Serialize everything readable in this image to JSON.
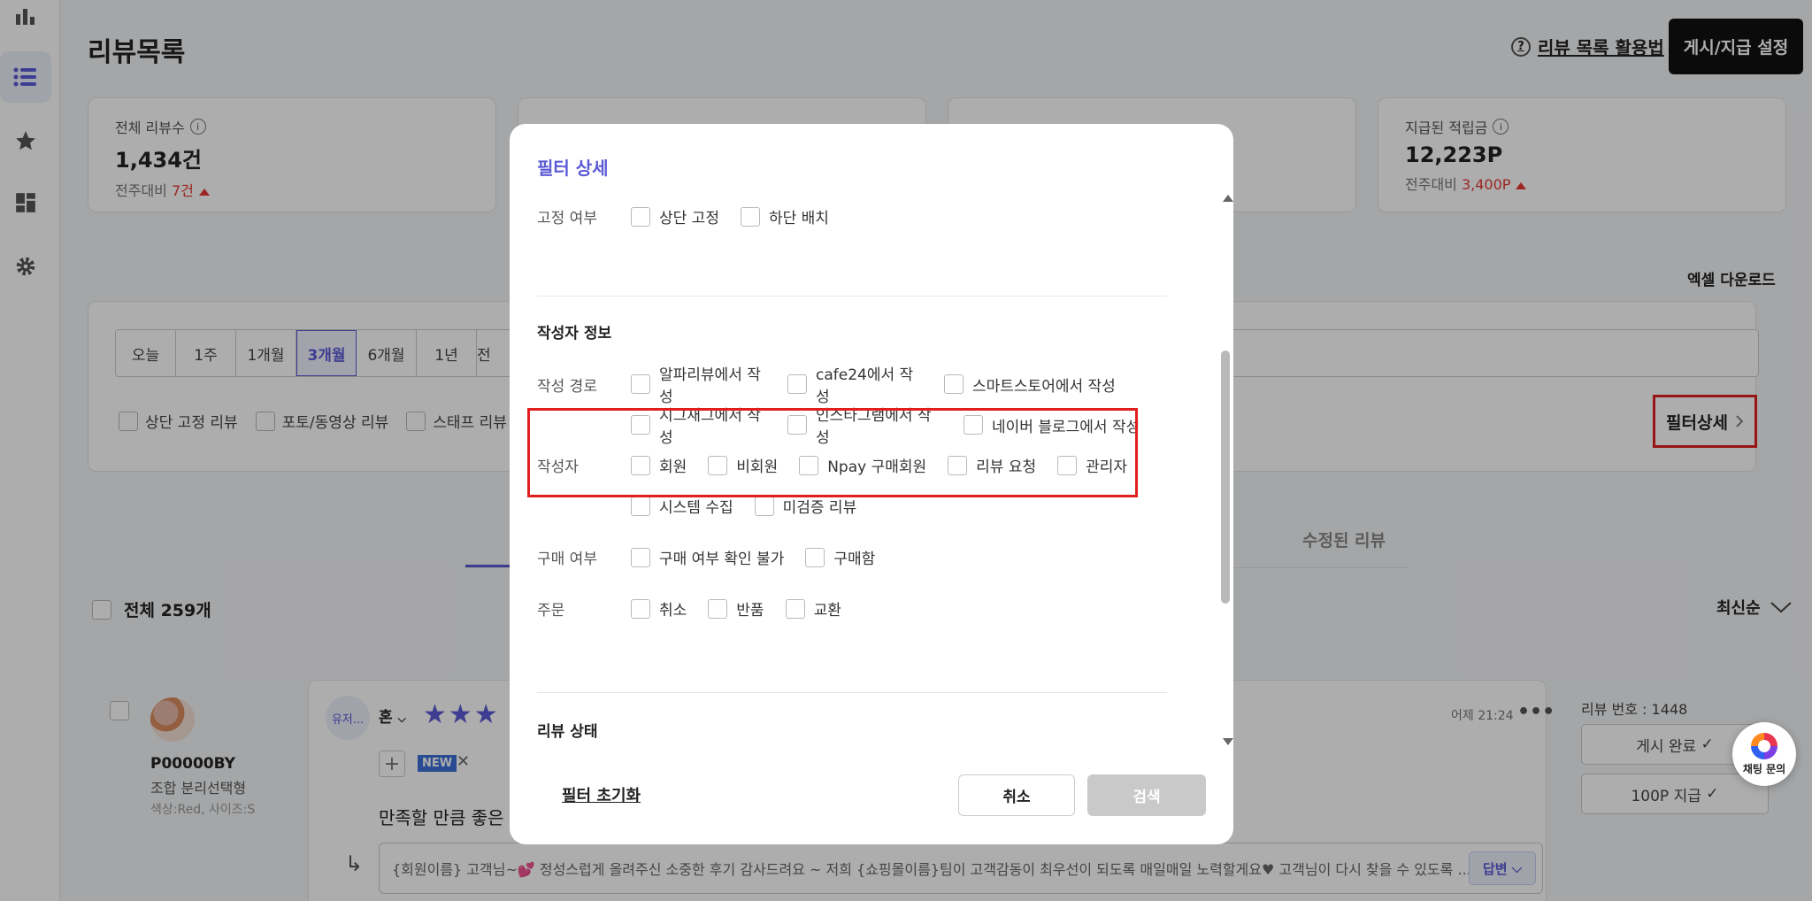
{
  "page": {
    "title": "리뷰목록"
  },
  "header": {
    "help_label": "리뷰 목록 활용법",
    "settings_label": "게시/지급 설정"
  },
  "stats": [
    {
      "label": "전체 리뷰수",
      "value": "1,434건",
      "delta_prefix": "전주대비",
      "delta": "7건"
    },
    {
      "label": "지급된 적립금",
      "value": "12,223P",
      "delta_prefix": "전주대비",
      "delta": "3,400P"
    }
  ],
  "excel_label": "엑셀 다운로드",
  "periods": [
    "오늘",
    "1주",
    "1개월",
    "3개월",
    "6개월",
    "1년",
    "전"
  ],
  "periods_active": "3개월",
  "quick_filters": [
    "상단 고정 리뷰",
    "포토/동영상 리뷰",
    "스태프 리뷰"
  ],
  "filter_detail_label": "필터상세",
  "tabs": {
    "edited": "수정된 리뷰"
  },
  "list": {
    "total": "전체 259개",
    "sort": "최신순"
  },
  "review": {
    "product_code": "P00000BY",
    "product_name": "조합 분리선택형",
    "product_option": "색상:Red, 사이즈:S",
    "user_chip": "유저...",
    "reviewer": "혼",
    "date": "어제 21:24",
    "badge": "NEW",
    "body": "만족할 만큼 좋은 상",
    "reply": "{회원이름} 고객님~💕 정성스럽게 올려주신 소중한 후기 감사드려요 ~ 저희 {쇼핑몰이름}팀이 고객감동이 최우선이 되도록 매일매일 노력할게요♥ 고객님이 다시 찾을 수 있도록 ...",
    "reply_button": "답변",
    "number": "리뷰 번호 : 1448",
    "status_posted": "게시 완료",
    "status_points": "100P 지급"
  },
  "chat": {
    "label": "채팅 문의"
  },
  "modal": {
    "title": "필터 상세",
    "pin_label": "고정 여부",
    "pin_options": [
      "상단 고정",
      "하단 배치"
    ],
    "author_section": "작성자 정보",
    "source_label": "작성 경로",
    "source_options_row1": [
      "알파리뷰에서 작성",
      "cafe24에서 작성",
      "스마트스토어에서 작성"
    ],
    "source_options_row2": [
      "지그재그에서 작성",
      "인스타그램에서 작성",
      "네이버 블로그에서 작성"
    ],
    "author_label": "작성자",
    "author_options_row1": [
      "회원",
      "비회원",
      "Npay 구매회원",
      "리뷰 요청",
      "관리자"
    ],
    "author_options_row2": [
      "시스템 수집",
      "미검증 리뷰"
    ],
    "purchase_label": "구매 여부",
    "purchase_options": [
      "구매 여부 확인 불가",
      "구매함"
    ],
    "order_label": "주문",
    "order_options": [
      "취소",
      "반품",
      "교환"
    ],
    "status_section": "리뷰 상태",
    "reset_label": "필터 초기화",
    "cancel_label": "취소",
    "search_label": "검색"
  },
  "colors": {
    "accent": "#5b5bd6",
    "highlight": "#e02020",
    "danger": "#e53935"
  }
}
